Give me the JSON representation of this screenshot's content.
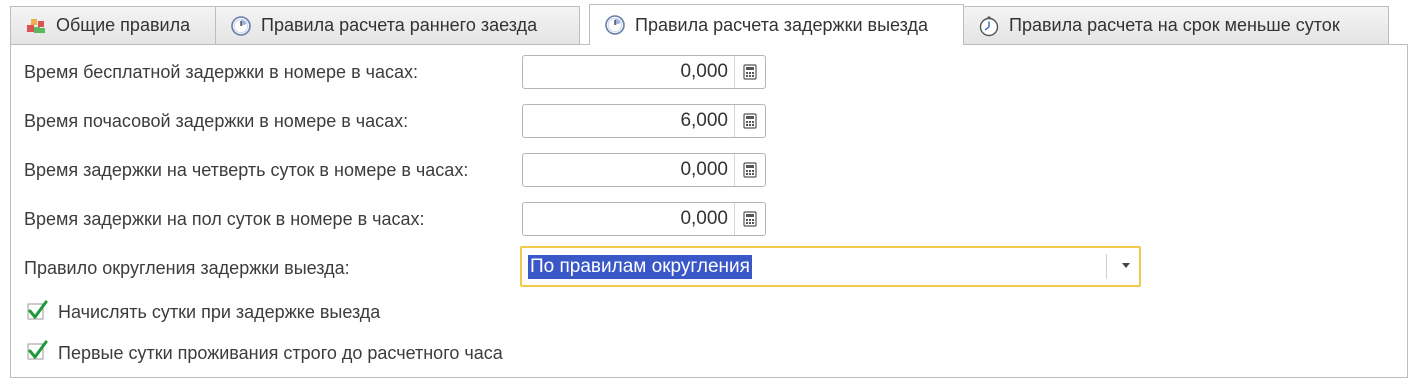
{
  "tabs": [
    {
      "label": "Общие правила",
      "icon": "rules-blocks-icon"
    },
    {
      "label": "Правила расчета раннего заезда",
      "icon": "clock-icon"
    },
    {
      "label": "Правила расчета задержки выезда",
      "icon": "clock-icon",
      "active": true
    },
    {
      "label": "Правила расчета на срок меньше суток",
      "icon": "pocket-watch-icon"
    }
  ],
  "fields": [
    {
      "label": "Время бесплатной задержки в номере в часах:",
      "value": "0,000"
    },
    {
      "label": "Время почасовой задержки в номере в часах:",
      "value": "6,000"
    },
    {
      "label": "Время задержки на четверть суток в номере в часах:",
      "value": "0,000"
    },
    {
      "label": "Время задержки на пол суток в номере в часах:",
      "value": "0,000"
    }
  ],
  "rounding": {
    "label": "Правило округления задержки выезда:",
    "value": "По правилам округления"
  },
  "checkboxes": [
    {
      "label": "Начислять сутки при задержке выезда",
      "checked": true
    },
    {
      "label": "Первые сутки проживания строго до расчетного часа",
      "checked": true
    }
  ],
  "colors": {
    "focus_border": "#f2c94a",
    "selection": "#3a57c8",
    "check": "#1e9a3a"
  }
}
